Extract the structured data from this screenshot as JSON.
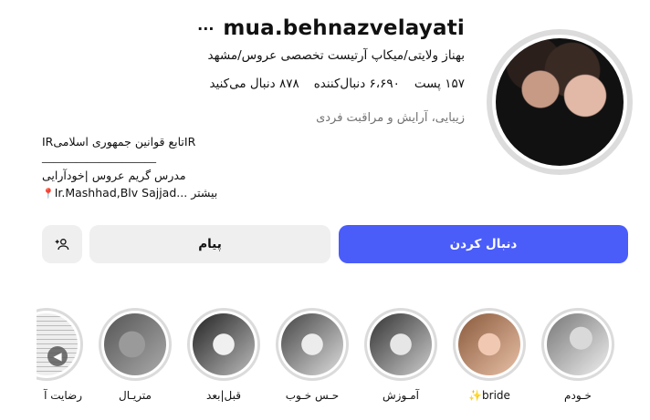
{
  "profile": {
    "username": "mua.behnazvelayati",
    "more_icon": "...",
    "fullname": "بهناز ولایتی/میکاپ آرتیست تخصصی عروس/مشهد",
    "stats": {
      "posts": "۱۵۷ پست",
      "followers": "۶،۶۹۰ دنبال‌کننده",
      "following": "۸۷۸ دنبال می‌کنید"
    },
    "category": "زیبایی، آرایش و مراقبت فردی",
    "bio_lines": [
      "IRتابع قوانین جمهوری اسلامیIR",
      "____________________",
      "مدرس گریم عروس |خودآرایی",
      "Ir.Mashhad,Blv Sajjad... بیشتر"
    ],
    "bio_pin_icon": "📍"
  },
  "actions": {
    "follow": "دنبال کردن",
    "message": "پیام",
    "add_user_icon": "add-user-icon"
  },
  "highlights": [
    {
      "label": "خـودم"
    },
    {
      "label": "bride✨"
    },
    {
      "label": "آمـوزش"
    },
    {
      "label": "حـس خـوب"
    },
    {
      "label": "قبل|بعد"
    },
    {
      "label": "متریـال"
    },
    {
      "label": "رضایت آ"
    }
  ],
  "colors": {
    "accent": "#4a5df9",
    "secondary_button": "#efefef",
    "muted_text": "#737373"
  }
}
